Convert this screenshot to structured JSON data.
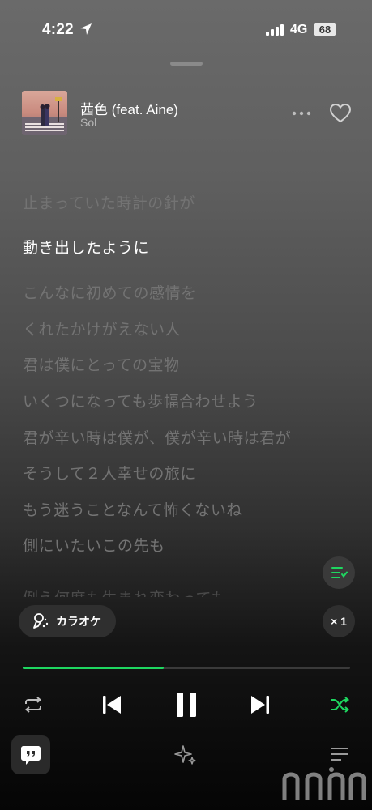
{
  "status_bar": {
    "time": "4:22",
    "network": "4G",
    "battery": "68"
  },
  "track": {
    "title": "茜色 (feat. Aine)",
    "artist": "Sol"
  },
  "lyrics": [
    "止まっていた時計の針が",
    "動き出したように",
    "こんなに初めての感情を",
    "くれたかけがえない人",
    "君は僕にとっての宝物",
    "いくつになっても歩幅合わせよう",
    "君が辛い時は僕が、僕が辛い時は君が",
    "そうして２人幸せの旅に",
    "もう迷うことなんて怖くないね",
    "側にいたいこの先も",
    "例え何度も生まれ変わっても"
  ],
  "active_lyric_index": 1,
  "karaoke": {
    "label": "カラオケ"
  },
  "speed": {
    "label": "× 1"
  },
  "playback": {
    "progress_fraction": 0.43,
    "state": "playing"
  },
  "colors": {
    "accent": "#1ed760"
  },
  "icons": {
    "location": "location-arrow-icon",
    "more": "more-dots-icon",
    "like": "heart-icon",
    "repeat": "repeat-icon",
    "prev": "skip-previous-icon",
    "pause": "pause-icon",
    "next": "skip-next-icon",
    "shuffle": "shuffle-icon",
    "lyrics_menu": "lyrics-list-icon",
    "chat": "chat-bubble-icon",
    "sparkle": "sparkle-icon",
    "queue": "queue-icon"
  }
}
